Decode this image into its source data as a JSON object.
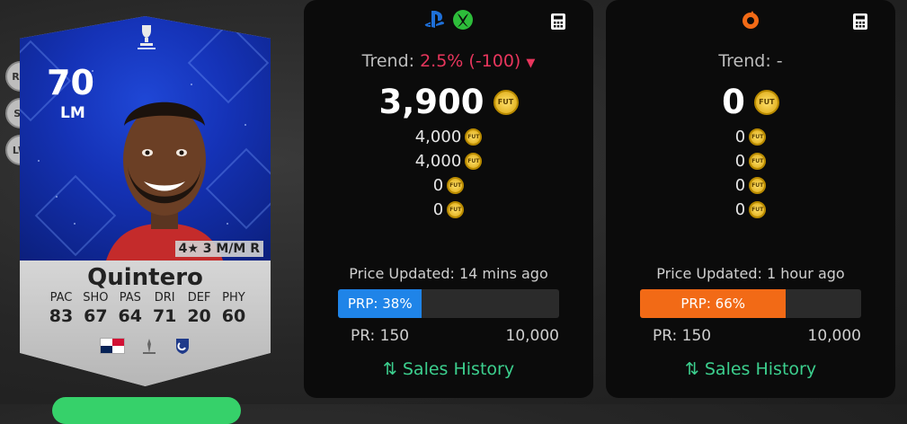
{
  "card": {
    "positions": [
      "RM",
      "ST",
      "LW"
    ],
    "rating": "70",
    "position": "LM",
    "meta": "4★ 3 M/M R",
    "name": "Quintero",
    "stats": [
      {
        "label": "PAC",
        "value": "83"
      },
      {
        "label": "SHO",
        "value": "67"
      },
      {
        "label": "PAS",
        "value": "64"
      },
      {
        "label": "DRI",
        "value": "71"
      },
      {
        "label": "DEF",
        "value": "20"
      },
      {
        "label": "PHY",
        "value": "60"
      }
    ]
  },
  "panels": [
    {
      "platform_icons": [
        "playstation-icon",
        "xbox-icon"
      ],
      "trend_label": "Trend:",
      "trend_value": "2.5% (-100)",
      "trend_direction": "down",
      "price": "3,900",
      "coin_text": "FUT",
      "prices": [
        "4,000",
        "4,000",
        "0",
        "0"
      ],
      "updated": "Price Updated: 14 mins ago",
      "prp_label": "PRP: 38%",
      "prp_fraction": 0.38,
      "prp_color": "#1f84e8",
      "pr_min": "PR: 150",
      "pr_max": "10,000",
      "sales_label": "Sales History"
    },
    {
      "platform_icons": [
        "origin-icon"
      ],
      "trend_label": "Trend:",
      "trend_value": "-",
      "trend_direction": "none",
      "price": "0",
      "coin_text": "FUT",
      "prices": [
        "0",
        "0",
        "0",
        "0"
      ],
      "updated": "Price Updated: 1 hour ago",
      "prp_label": "PRP: 66%",
      "prp_fraction": 0.66,
      "prp_color": "#f26a16",
      "pr_min": "PR: 150",
      "pr_max": "10,000",
      "sales_label": "Sales History"
    }
  ],
  "colors": {
    "trend_negative": "#e8365d",
    "sales_link": "#3ccf8e",
    "card_blue": "#1533b8"
  }
}
